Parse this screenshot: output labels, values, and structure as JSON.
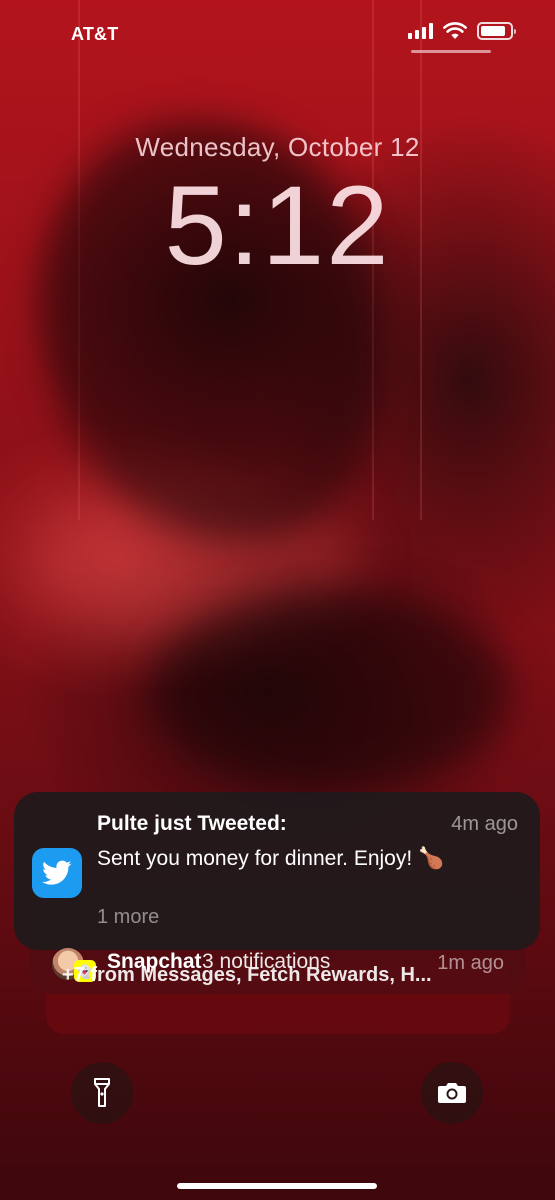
{
  "status_bar": {
    "carrier": "AT&T",
    "signal_bars": 4,
    "battery_level_percent": 85
  },
  "lock_screen": {
    "date": "Wednesday, October 12",
    "time": "5:12"
  },
  "notifications": {
    "primary": {
      "app_icon": "twitter-icon",
      "title": "Pulte just Tweeted:",
      "time": "4m ago",
      "body": "Sent you money for dinner. Enjoy! 🍗",
      "more": "1 more"
    },
    "snapchat": {
      "app": "Snapchat",
      "count_text": "3 notifications",
      "time": "1m ago"
    },
    "summary": "+7 from Messages, Fetch Rewards, H..."
  },
  "controls": {
    "left": "flashlight-icon",
    "right": "camera-icon"
  },
  "colors": {
    "twitter_blue": "#1d9bf0",
    "snapchat_yellow": "#fffc00"
  }
}
